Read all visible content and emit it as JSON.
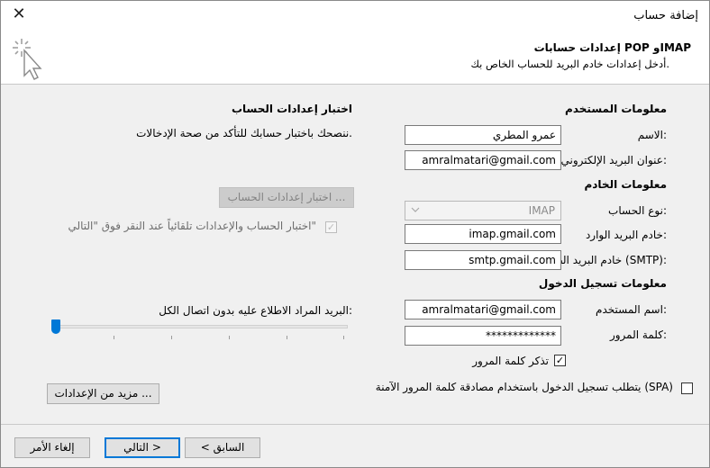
{
  "window": {
    "title": "إضافة حساب",
    "close_glyph": "✕"
  },
  "header": {
    "title": "إعدادات حسابات POP وIMAP",
    "subtitle": "أدخل إعدادات خادم البريد  للحساب الخاص بك.",
    "logo_icon": "cursor-sparkle-icon"
  },
  "user_info": {
    "section": "معلومات المستخدم",
    "name_label": "الاسم:",
    "name_value": "عمرو المطري",
    "email_label": "عنوان البريد الإلكتروني:",
    "email_value": "amralmatari@gmail.com"
  },
  "server_info": {
    "section": "معلومات الخادم",
    "account_type_label": "نوع الحساب:",
    "account_type_value": "IMAP",
    "incoming_label": "خادم البريد الوارد:",
    "incoming_value": "imap.gmail.com",
    "outgoing_label": "خادم البريد الصادر (SMTP):",
    "outgoing_value": "smtp.gmail.com"
  },
  "login_info": {
    "section": "معلومات تسجيل الدخول",
    "username_label": "اسم المستخدم:",
    "username_value": "amralmatari@gmail.com",
    "password_label": "كلمة المرور:",
    "password_value": "*************",
    "remember_label": "تذكر كلمة المرور",
    "remember_checked": true,
    "spa_label": "يتطلب تسجيل الدخول باستخدام مصادقة كلمة المرور الآمنة  (SPA)",
    "spa_checked": false
  },
  "test_settings": {
    "section": "اختبار إعدادات الحساب",
    "description": "ننصحك باختبار حسابك للتأكد من صحة الإدخالات.",
    "test_button": "اختبار إعدادات الحساب ...",
    "auto_test_label": "اختبار الحساب والإعدادات تلقائياً عند النقر فوق \"التالي\"",
    "auto_test_checked": true
  },
  "offline": {
    "label": "البريد المراد الاطلاع عليه بدون اتصال:",
    "value": "الكل",
    "slider_fraction": 0
  },
  "more_settings_button": "مزيد من الإعدادات ...",
  "footer": {
    "back_button": "< السابق",
    "next_button": "التالي >",
    "cancel_button": "إلغاء الأمر"
  },
  "colors": {
    "accent": "#0078d7",
    "background": "#f0f0f0"
  }
}
